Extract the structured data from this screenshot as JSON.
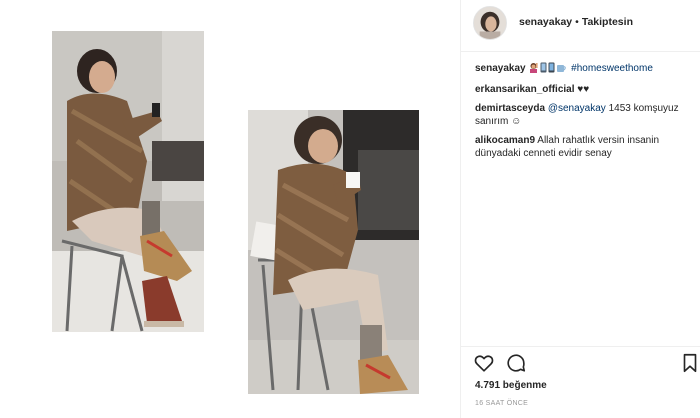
{
  "colors": {
    "link": "#003569",
    "text": "#262626",
    "muted": "#999999",
    "border": "#efefef"
  },
  "header": {
    "username": "senayakay",
    "separator": "•",
    "follow_status": "Takiptesin"
  },
  "comments": [
    {
      "user": "senayakay",
      "emojis": [
        "woman-raising-hand-emoji",
        "phone-emoji",
        "mug-emoji"
      ],
      "hashtag": "#homesweethome"
    },
    {
      "user": "erkansarikan_official",
      "text": "♥♥"
    },
    {
      "user": "demirtasceyda",
      "mention": "@senayakay",
      "text": " 1453 komşuyuz sanırım ☺"
    },
    {
      "user": "alikocaman9",
      "text": "Allah rahatlık versin insanin dünyadaki cenneti evidir senay"
    }
  ],
  "actions": {
    "like_icon": "heart-icon",
    "comment_icon": "speech-bubble-icon",
    "save_icon": "bookmark-icon"
  },
  "likes": "4.791 beğenme",
  "timestamp": "16 SAAT ÖNCE"
}
